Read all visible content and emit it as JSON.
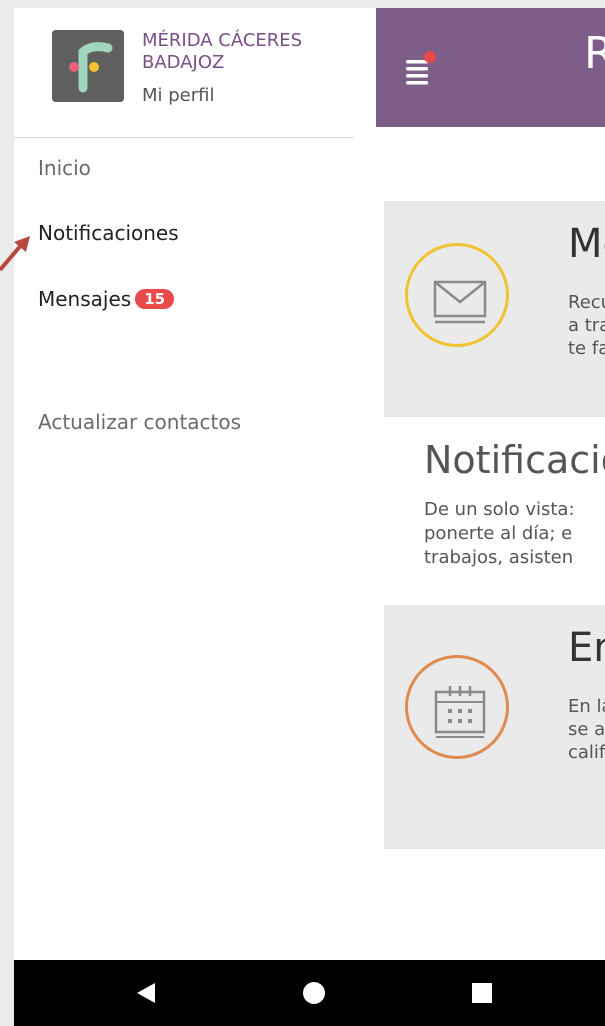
{
  "drawer": {
    "org_name": "MÉRIDA CÁCERES BADAJOZ",
    "profile_link": "Mi perfil",
    "items": [
      {
        "label": "Inicio"
      },
      {
        "label": "Notificaciones"
      },
      {
        "label": "Mensajes",
        "badge": "15"
      },
      {
        "label": "Actualizar contactos"
      }
    ]
  },
  "appbar": {
    "title": "R"
  },
  "cards": [
    {
      "icon": "envelope-icon",
      "accent": "#f0c330",
      "title": "Me",
      "text": "Recu\na tra\nte fa"
    },
    {
      "icon": "calendar-icon",
      "accent": "#e08a4d",
      "title": "En",
      "text": "En la\nse a\ncalif"
    }
  ],
  "section": {
    "title": "Notificacio",
    "text": "De un solo vista:\nponerte al día; e\ntrabajos, asisten"
  },
  "colors": {
    "brand": "#7c5e88",
    "badge": "#e84a4a",
    "notification_dot": "#e84a4a"
  }
}
